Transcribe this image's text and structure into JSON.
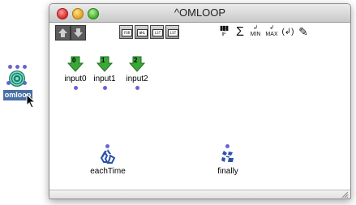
{
  "window": {
    "title": "^OMLOOP",
    "close_icon": "close-traffic-light",
    "minimize_icon": "minimize-traffic-light",
    "zoom_icon": "zoom-traffic-light"
  },
  "desktop_box": {
    "label": "omloop",
    "icon": "spiral-loop-icon"
  },
  "toolbar": {
    "arrows": [
      "arrow-up-icon",
      "arrow-down-icon"
    ],
    "types": [
      {
        "label": "FOR",
        "name": "for-iterator-button"
      },
      {
        "label": "WHL",
        "name": "while-iterator-button"
      },
      {
        "label": "LST",
        "name": "list-iterator-button"
      },
      {
        "label": "LST",
        "name": "onlist-iterator-button"
      }
    ],
    "tools": [
      {
        "name": "counter-icon",
        "text": "▮▮▮",
        "sub": "IF"
      },
      {
        "name": "sum-icon",
        "text": "Σ",
        "sub": ""
      },
      {
        "name": "min-icon",
        "text": "↲",
        "sub": "MIN"
      },
      {
        "name": "max-icon",
        "text": "↲",
        "sub": "MAX"
      },
      {
        "name": "collect-icon",
        "text": "(↲)",
        "sub": ""
      },
      {
        "name": "accum-icon",
        "text": "✎",
        "sub": ""
      }
    ]
  },
  "inputs": [
    {
      "index": "0",
      "label": "input0"
    },
    {
      "index": "1",
      "label": "input1"
    },
    {
      "index": "2",
      "label": "input2"
    }
  ],
  "outputs": [
    {
      "label": "eachTime",
      "icon": "recycle-icon"
    },
    {
      "label": "finally",
      "icon": "recycle-broken-icon"
    }
  ],
  "colors": {
    "input_arrow": "#3aa838",
    "connector_dot": "#6a62d6",
    "output_icon": "#2b53a8"
  }
}
